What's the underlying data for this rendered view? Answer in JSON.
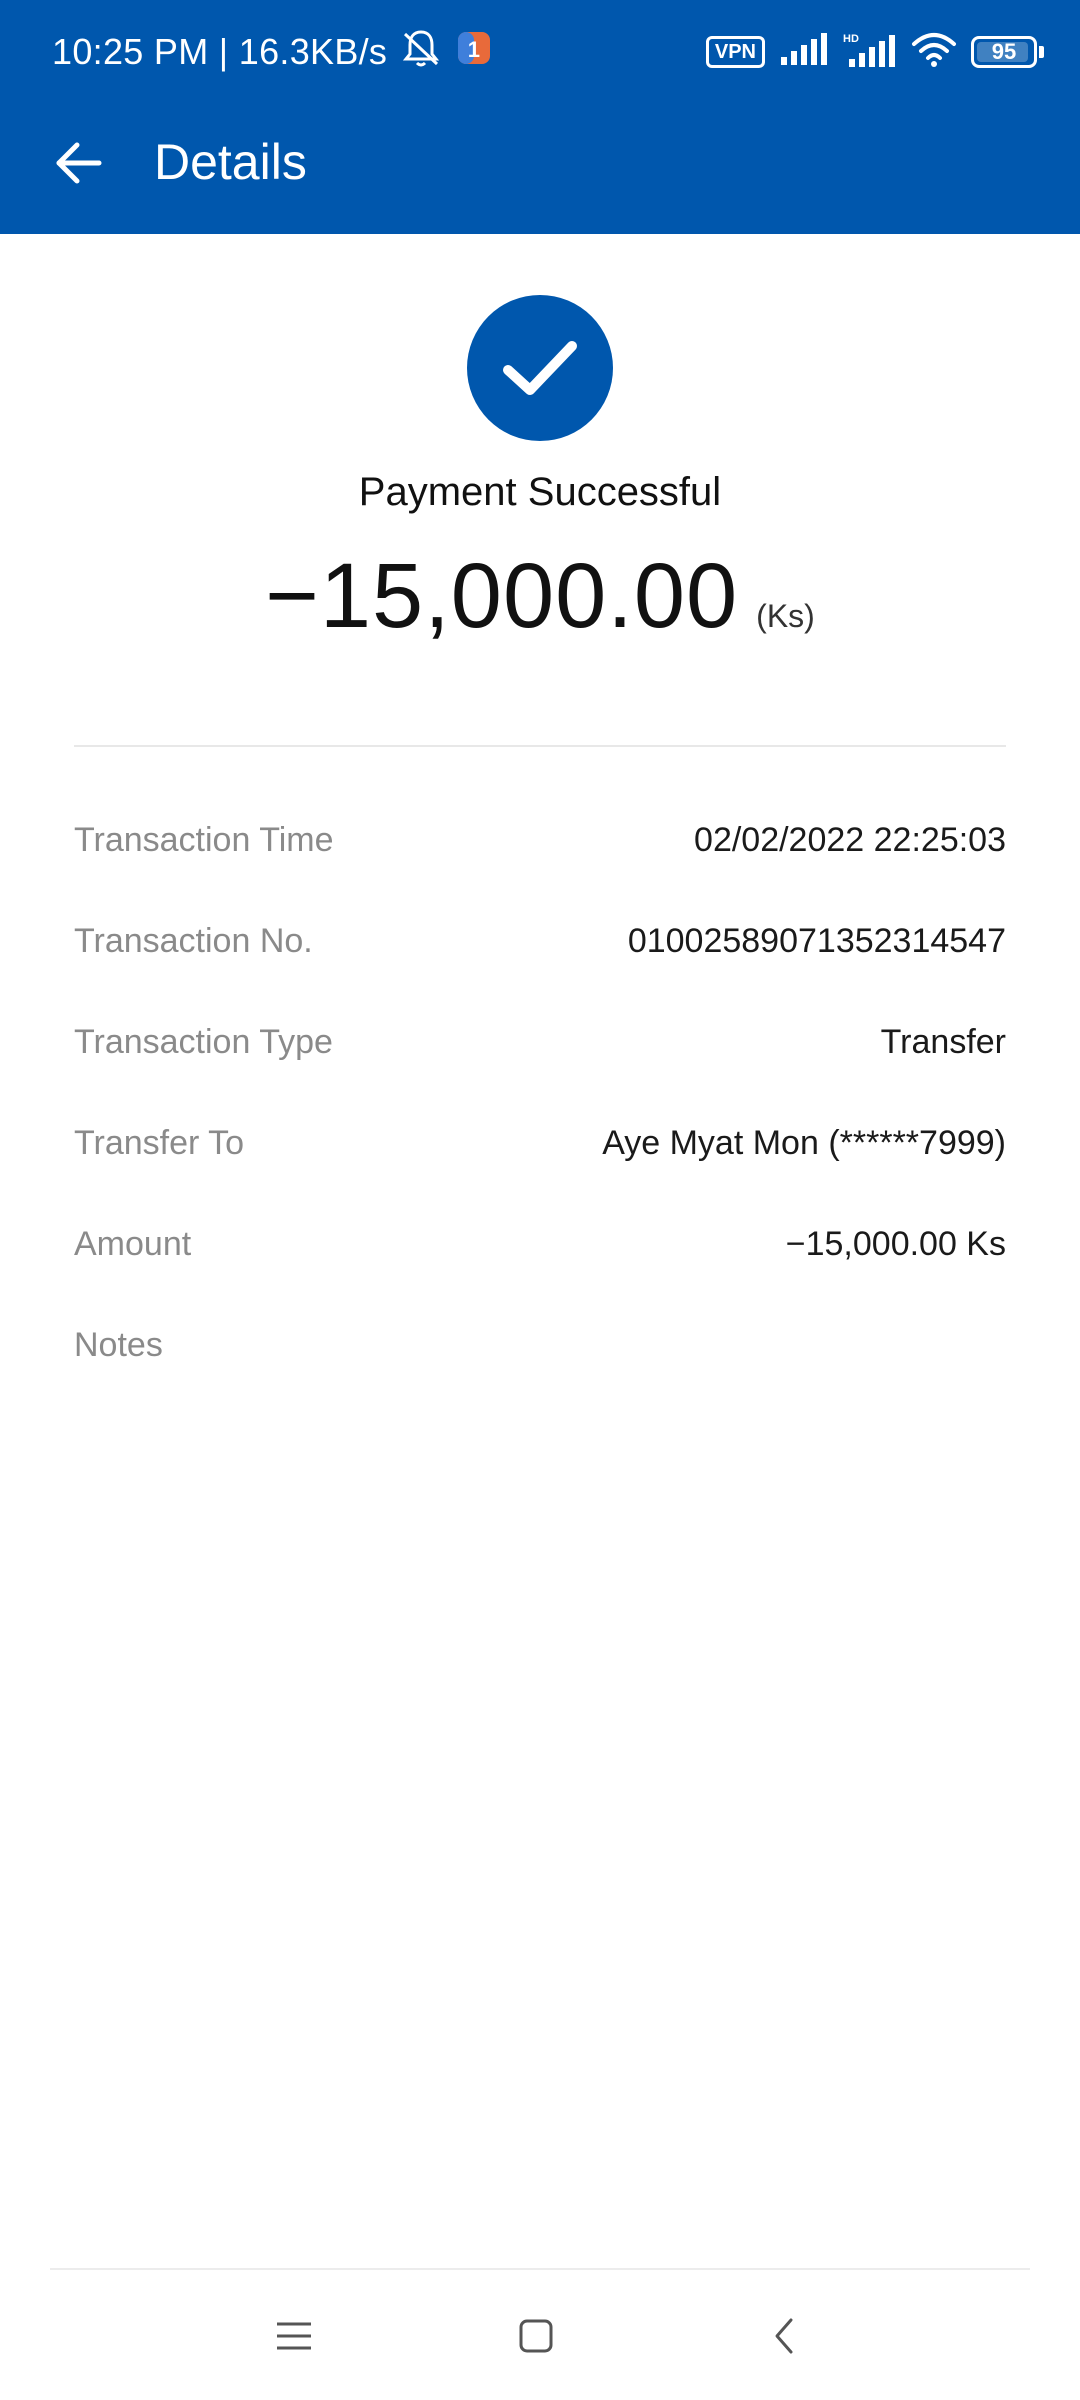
{
  "status_bar": {
    "time_speed": "10:25 PM | 16.3KB/s",
    "vpn": "VPN",
    "battery": "95",
    "battery_level": 0.95
  },
  "app_bar": {
    "title": "Details"
  },
  "summary": {
    "status": "Payment Successful",
    "amount": "−15,000.00",
    "unit": "(Ks)"
  },
  "details": [
    {
      "label": "Transaction Time",
      "value": "02/02/2022 22:25:03"
    },
    {
      "label": "Transaction No.",
      "value": "01002589071352314547"
    },
    {
      "label": "Transaction Type",
      "value": "Transfer"
    },
    {
      "label": "Transfer To",
      "value": "Aye Myat Mon (******7999)"
    },
    {
      "label": "Amount",
      "value": "−15,000.00 Ks"
    },
    {
      "label": "Notes",
      "value": ""
    }
  ],
  "colors": {
    "brand": "#0057ad",
    "label": "#8a8a8a",
    "value": "#1a1a1a"
  },
  "icons": {
    "back": "arrow-left-icon",
    "success": "check-icon",
    "nav_menu": "menu-icon",
    "nav_home": "home-square-icon",
    "nav_back": "chevron-left-icon"
  }
}
